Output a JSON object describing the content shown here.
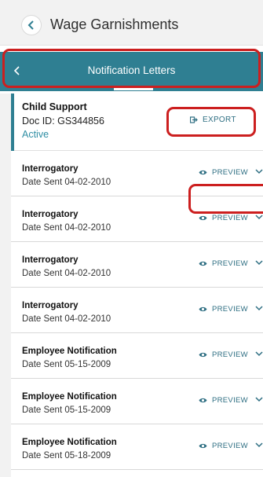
{
  "header": {
    "title": "Wage Garnishments"
  },
  "tab_bar": {
    "title": "Notification Letters"
  },
  "summary": {
    "name": "Child Support",
    "doc_id": "Doc ID: GS344856",
    "status": "Active",
    "export_label": "EXPORT"
  },
  "letters": [
    {
      "title": "Interrogatory",
      "date": "Date Sent 04-02-2010",
      "action": "PREVIEW"
    },
    {
      "title": "Interrogatory",
      "date": "Date Sent 04-02-2010",
      "action": "PREVIEW"
    },
    {
      "title": "Interrogatory",
      "date": "Date Sent 04-02-2010",
      "action": "PREVIEW"
    },
    {
      "title": "Interrogatory",
      "date": "Date Sent 04-02-2010",
      "action": "PREVIEW"
    },
    {
      "title": "Employee Notification",
      "date": "Date Sent 05-15-2009",
      "action": "PREVIEW"
    },
    {
      "title": "Employee Notification",
      "date": "Date Sent 05-15-2009",
      "action": "PREVIEW"
    },
    {
      "title": "Employee Notification",
      "date": "Date Sent 05-18-2009",
      "action": "PREVIEW"
    }
  ],
  "colors": {
    "accent": "#2f7f92",
    "annotation": "#cc1f1f"
  },
  "icons": {
    "back": "chevron-left-icon",
    "export": "export-icon",
    "preview": "eye-icon",
    "expand": "chevron-down-icon"
  }
}
